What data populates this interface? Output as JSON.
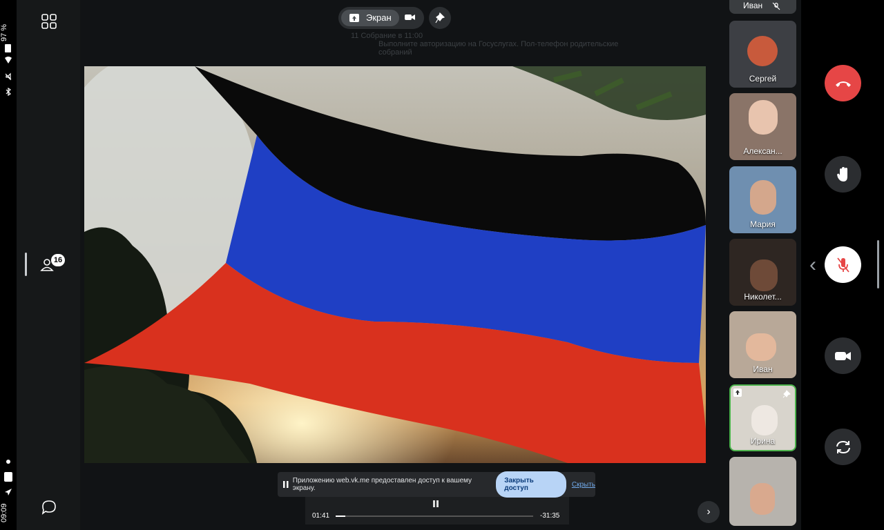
{
  "status": {
    "battery": "97 %",
    "time": "09:09"
  },
  "topbar": {
    "screen_label": "Экран"
  },
  "sidebar": {
    "participants_badge": "16"
  },
  "background_chat": {
    "line1": "11 Собрание в 11:00",
    "line2": "Выполните авторизацию на Госуслугах. Пол-телефон родительские",
    "line3": "собраний"
  },
  "participants": [
    {
      "name": "Иван"
    },
    {
      "name": "Сергей"
    },
    {
      "name": "Алексан..."
    },
    {
      "name": "Мария"
    },
    {
      "name": "Николет..."
    },
    {
      "name": "Иван"
    },
    {
      "name": "Ирина"
    },
    {
      "name": ""
    }
  ],
  "notice": {
    "text": "Приложению web.vk.me предоставлен доступ к вашему экрану.",
    "close_access": "Закрыть доступ",
    "hide": "Скрыть"
  },
  "player": {
    "elapsed": "01:41",
    "remaining": "-31:35",
    "progress": 0.05
  },
  "colors": {
    "end_call": "#e64646",
    "active_border": "#4bb34b",
    "accent": "#2d81e0"
  }
}
